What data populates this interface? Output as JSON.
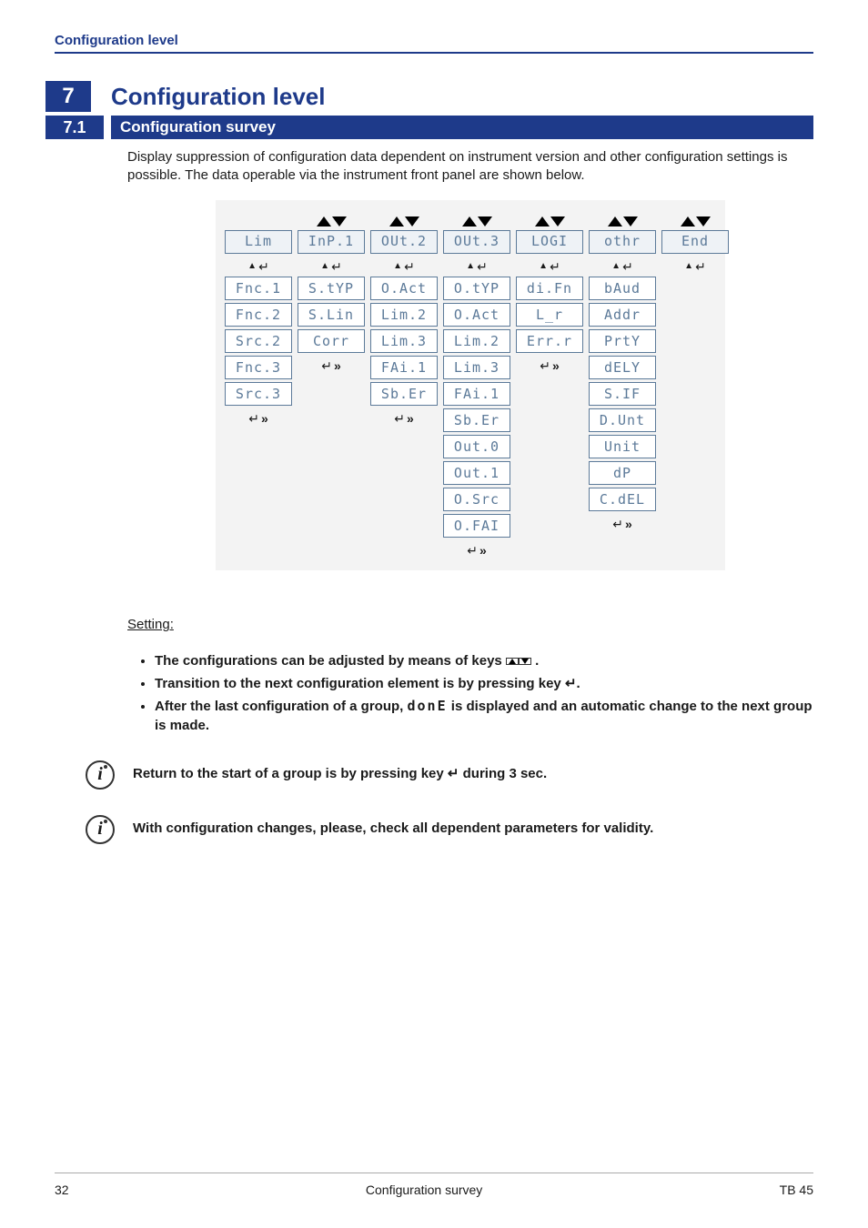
{
  "header": {
    "running": "Configuration level"
  },
  "chapter": {
    "num": "7",
    "title": "Configuration level"
  },
  "section": {
    "num": "7.1",
    "title": "Configuration survey"
  },
  "intro": "Display suppression of configuration data dependent on instrument version and other configuration settings is possible. The data operable via the instrument front panel are shown below.",
  "diagram": {
    "columns": [
      {
        "head": "Lim",
        "items": [
          "Fnc.1",
          "Fnc.2",
          "Src.2",
          "Fnc.3",
          "Src.3"
        ]
      },
      {
        "head": "InP.1",
        "items": [
          "S.tYP",
          "S.Lin",
          "Corr"
        ]
      },
      {
        "head": "OUt.2",
        "items": [
          "O.Act",
          "Lim.2",
          "Lim.3",
          "FAi.1",
          "Sb.Er"
        ]
      },
      {
        "head": "OUt.3",
        "items": [
          "O.tYP",
          "O.Act",
          "Lim.2",
          "Lim.3",
          "FAi.1",
          "Sb.Er",
          "Out.0",
          "Out.1",
          "O.Src",
          "O.FAI"
        ]
      },
      {
        "head": "LOGI",
        "items": [
          "di.Fn",
          "L_r",
          "Err.r"
        ]
      },
      {
        "head": "othr",
        "items": [
          "bAud",
          "Addr",
          "PrtY",
          "dELY",
          "S.IF",
          "D.Unt",
          "Unit",
          "dP",
          "C.dEL"
        ]
      },
      {
        "head": "End",
        "items": []
      }
    ]
  },
  "setting": {
    "heading": "Setting:",
    "bullets": [
      {
        "pre": "The configurations can be adjusted by means of keys ",
        "post": " ."
      },
      {
        "pre": "Transition to the next configuration element is by pressing key ",
        "post": "."
      },
      {
        "pre": "After the last configuration of a group, ",
        "code": "donE",
        "post": " is displayed and an automatic change to the next group is made."
      }
    ]
  },
  "notes": [
    "Return to the start of a group is by pressing key  ↵ during 3 sec.",
    "With configuration changes, please, check all dependent parameters for validity."
  ],
  "footer": {
    "page": "32",
    "center": "Configuration survey",
    "right": "TB 45"
  }
}
